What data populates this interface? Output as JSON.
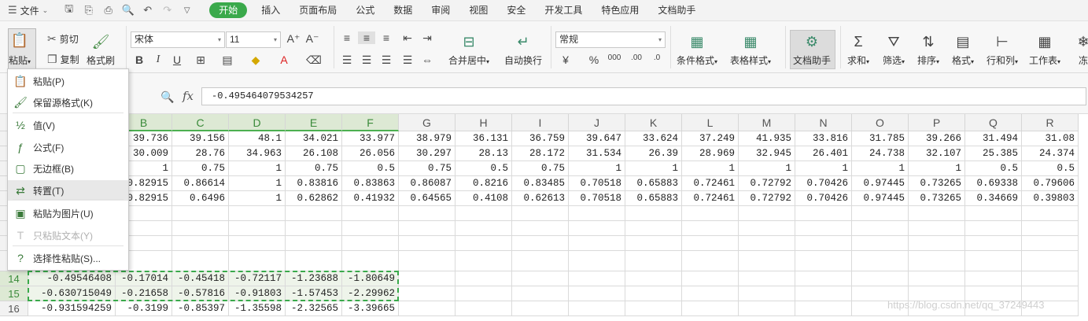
{
  "menu": {
    "file_label": "文件",
    "tabs": [
      "开始",
      "插入",
      "页面布局",
      "公式",
      "数据",
      "审阅",
      "视图",
      "安全",
      "开发工具",
      "特色应用",
      "文档助手"
    ],
    "active_tab": "开始"
  },
  "ribbon": {
    "paste": "粘贴",
    "cut": "剪切",
    "copy": "复制",
    "format_painter": "格式刷",
    "font_name": "宋体",
    "font_size": "11",
    "merge_center": "合并居中",
    "wrap_text": "自动换行",
    "number_format": "常规",
    "conditional_format": "条件格式",
    "table_style": "表格样式",
    "doc_assistant": "文档助手",
    "sum": "求和",
    "filter": "筛选",
    "sort": "排序",
    "format": "格式",
    "rows_cols": "行和列",
    "worksheet": "工作表",
    "freeze": "冻"
  },
  "formula_bar": {
    "fx": "fx",
    "value": "-0.495464079534257"
  },
  "paste_menu": [
    {
      "label": "粘贴(P)",
      "icon": "clipboard-icon",
      "state": "normal"
    },
    {
      "label": "保留源格式(K)",
      "icon": "clipboard-brush-icon",
      "state": "normal"
    },
    {
      "label": "值(V)",
      "icon": "clipboard-123-icon",
      "state": "normal"
    },
    {
      "label": "公式(F)",
      "icon": "clipboard-fx-icon",
      "state": "normal"
    },
    {
      "label": "无边框(B)",
      "icon": "clipboard-noborder-icon",
      "state": "normal"
    },
    {
      "label": "转置(T)",
      "icon": "clipboard-transpose-icon",
      "state": "highlighted"
    },
    {
      "label": "粘贴为图片(U)",
      "icon": "clipboard-image-icon",
      "state": "normal"
    },
    {
      "label": "只粘贴文本(Y)",
      "icon": "clipboard-text-icon",
      "state": "disabled"
    },
    {
      "label": "选择性粘贴(S)...",
      "icon": "clipboard-special-icon",
      "state": "normal"
    }
  ],
  "grid": {
    "columns": [
      "B",
      "C",
      "D",
      "E",
      "F",
      "G",
      "H",
      "I",
      "J",
      "K",
      "L",
      "M",
      "N",
      "O",
      "P",
      "Q",
      "R"
    ],
    "selected_columns": [
      "B",
      "C",
      "D",
      "E",
      "F"
    ],
    "rows": [
      {
        "n": "",
        "cells": [
          "",
          "39.736",
          "39.156",
          "48.1",
          "34.021",
          "33.977",
          "38.979",
          "36.131",
          "36.759",
          "39.647",
          "33.624",
          "37.249",
          "41.935",
          "33.816",
          "31.785",
          "39.266",
          "31.494",
          "31.08"
        ]
      },
      {
        "n": "",
        "cells": [
          "",
          "30.009",
          "28.76",
          "34.963",
          "26.108",
          "26.056",
          "30.297",
          "28.13",
          "28.172",
          "31.534",
          "26.39",
          "28.969",
          "32.945",
          "26.401",
          "24.738",
          "32.107",
          "25.385",
          "24.374"
        ]
      },
      {
        "n": "",
        "cells": [
          "",
          "1",
          "0.75",
          "1",
          "0.75",
          "0.5",
          "0.75",
          "0.5",
          "0.75",
          "1",
          "1",
          "1",
          "1",
          "1",
          "1",
          "1",
          "0.5",
          "0.5"
        ]
      },
      {
        "n": "",
        "cells": [
          "",
          "0.82915",
          "0.86614",
          "1",
          "0.83816",
          "0.83863",
          "0.86087",
          "0.8216",
          "0.83485",
          "0.70518",
          "0.65883",
          "0.72461",
          "0.72792",
          "0.70426",
          "0.97445",
          "0.73265",
          "0.69338",
          "0.79606"
        ]
      },
      {
        "n": "",
        "cells": [
          "",
          "0.82915",
          "0.6496",
          "1",
          "0.62862",
          "0.41932",
          "0.64565",
          "0.4108",
          "0.62613",
          "0.70518",
          "0.65883",
          "0.72461",
          "0.72792",
          "0.70426",
          "0.97445",
          "0.73265",
          "0.34669",
          "0.39803"
        ]
      },
      {
        "n": "",
        "cells": [
          "",
          "",
          "",
          "",
          "",
          "",
          "",
          "",
          "",
          "",
          "",
          "",
          "",
          "",
          "",
          "",
          "",
          ""
        ]
      },
      {
        "n": "",
        "cells": [
          "",
          "",
          "",
          "",
          "",
          "",
          "",
          "",
          "",
          "",
          "",
          "",
          "",
          "",
          "",
          "",
          "",
          ""
        ]
      },
      {
        "n": "",
        "cells": [
          "",
          "",
          "",
          "",
          "",
          "",
          "",
          "",
          "",
          "",
          "",
          "",
          "",
          "",
          "",
          "",
          "",
          ""
        ]
      },
      {
        "n": "",
        "cells": [
          "",
          "",
          "",
          "",
          "",
          "",
          "",
          "",
          "",
          "",
          "",
          "",
          "",
          "",
          "",
          "",
          "",
          ""
        ]
      },
      {
        "n": "14",
        "cells": [
          "-0.49546408",
          "-0.17014",
          "-0.45418",
          "-0.72117",
          "-1.23688",
          "-1.80649",
          "",
          "",
          "",
          "",
          "",
          "",
          "",
          "",
          "",
          "",
          "",
          ""
        ]
      },
      {
        "n": "15",
        "cells": [
          "-0.630715049",
          "-0.21658",
          "-0.57816",
          "-0.91803",
          "-1.57453",
          "-2.29962",
          "",
          "",
          "",
          "",
          "",
          "",
          "",
          "",
          "",
          "",
          "",
          ""
        ]
      },
      {
        "n": "16",
        "cells": [
          "-0.931594259",
          "-0.3199",
          "-0.85397",
          "-1.35598",
          "-2.32565",
          "-3.39665",
          "",
          "",
          "",
          "",
          "",
          "",
          "",
          "",
          "",
          "",
          "",
          ""
        ]
      }
    ]
  },
  "watermark": "https://blog.csdn.net/qq_37249443",
  "colors": {
    "accent": "#3aa94b",
    "selection": "#dde9d4"
  }
}
